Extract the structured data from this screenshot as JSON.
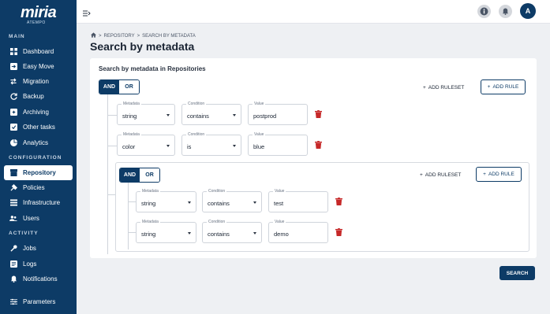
{
  "app": {
    "logo_text": "miria",
    "logo_sub": "ATEMPO"
  },
  "sidebar": {
    "sections": {
      "main": "MAIN",
      "configuration": "CONFIGURATION",
      "activity": "ACTIVITY"
    },
    "items": [
      {
        "label": "Dashboard",
        "icon": "dashboard-icon"
      },
      {
        "label": "Easy Move",
        "icon": "easy-move-icon"
      },
      {
        "label": "Migration",
        "icon": "migration-icon"
      },
      {
        "label": "Backup",
        "icon": "backup-icon"
      },
      {
        "label": "Archiving",
        "icon": "archiving-icon"
      },
      {
        "label": "Other tasks",
        "icon": "other-tasks-icon"
      },
      {
        "label": "Analytics",
        "icon": "analytics-icon"
      },
      {
        "label": "Repository",
        "icon": "repository-icon",
        "active": true
      },
      {
        "label": "Policies",
        "icon": "policies-icon"
      },
      {
        "label": "Infrastructure",
        "icon": "infrastructure-icon"
      },
      {
        "label": "Users",
        "icon": "users-icon"
      },
      {
        "label": "Jobs",
        "icon": "jobs-icon"
      },
      {
        "label": "Logs",
        "icon": "logs-icon"
      },
      {
        "label": "Notifications",
        "icon": "notifications-icon"
      },
      {
        "label": "Parameters",
        "icon": "parameters-icon"
      }
    ]
  },
  "topbar": {
    "avatar_initial": "A"
  },
  "breadcrumb": {
    "repository": "REPOSITORY",
    "separator": ">",
    "current": "SEARCH BY METADATA"
  },
  "page": {
    "title": "Search by metadata"
  },
  "search_card": {
    "title": "Search by metadata in Repositories",
    "toggle": {
      "and": "AND",
      "or": "OR",
      "selected": "AND"
    },
    "add_ruleset": "ADD RULESET",
    "add_rule": "ADD RULE",
    "labels": {
      "metadata": "Metadata",
      "condition": "Condition",
      "value": "Value"
    },
    "rules": [
      {
        "metadata": "string",
        "condition": "contains",
        "value": "postprod"
      },
      {
        "metadata": "color",
        "condition": "is",
        "value": "blue"
      }
    ],
    "subgroup": {
      "toggle": {
        "and": "AND",
        "or": "OR",
        "selected": "AND"
      },
      "add_ruleset": "ADD RULESET",
      "add_rule": "ADD RULE",
      "rules": [
        {
          "metadata": "string",
          "condition": "contains",
          "value": "test"
        },
        {
          "metadata": "string",
          "condition": "contains",
          "value": "demo"
        }
      ]
    }
  },
  "actions": {
    "search": "SEARCH"
  },
  "colors": {
    "primary": "#0d3b66",
    "danger": "#c62828",
    "background": "#eef0f3"
  }
}
